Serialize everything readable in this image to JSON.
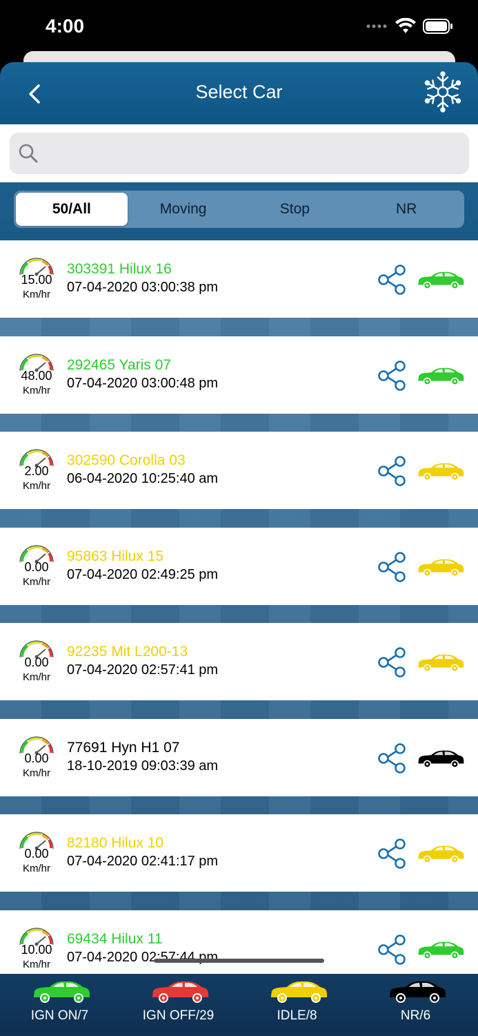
{
  "status_bar": {
    "time": "4:00"
  },
  "header": {
    "title": "Select Car",
    "back_icon": "chevron-left-icon",
    "action_icon": "snowflake-icon"
  },
  "search": {
    "placeholder": "",
    "value": ""
  },
  "filters": {
    "tabs": [
      {
        "label": "50/All",
        "active": true
      },
      {
        "label": "Moving"
      },
      {
        "label": "Stop"
      },
      {
        "label": "NR"
      }
    ]
  },
  "colors": {
    "green": "#2ecc2e",
    "yellow": "#f0d000",
    "red": "#e53935",
    "black": "#000000",
    "header": "#0f5585",
    "share": "#1b6fae"
  },
  "speed_unit": "Km/hr",
  "vehicles": [
    {
      "speed": "15.00",
      "name": "303391 Hilux 16",
      "datetime": "07-04-2020 03:00:38 pm",
      "status": "green"
    },
    {
      "speed": "48.00",
      "name": "292465 Yaris 07",
      "datetime": "07-04-2020 03:00:48 pm",
      "status": "green"
    },
    {
      "speed": "2.00",
      "name": "302590 Corolla 03",
      "datetime": "06-04-2020 10:25:40 am",
      "status": "yellow"
    },
    {
      "speed": "0.00",
      "name": "95863 Hilux 15",
      "datetime": "07-04-2020 02:49:25 pm",
      "status": "yellow"
    },
    {
      "speed": "0.00",
      "name": "92235 Mit L200-13",
      "datetime": "07-04-2020 02:57:41 pm",
      "status": "yellow"
    },
    {
      "speed": "0.00",
      "name": "77691 Hyn H1 07",
      "datetime": "18-10-2019 09:03:39 am",
      "status": "black"
    },
    {
      "speed": "0.00",
      "name": "82180 Hilux 10",
      "datetime": "07-04-2020 02:41:17 pm",
      "status": "yellow"
    },
    {
      "speed": "10.00",
      "name": "69434 Hilux 11",
      "datetime": "07-04-2020 02:57:44 pm",
      "status": "green"
    }
  ],
  "bottom_tabs": [
    {
      "label": "IGN ON/7",
      "status": "green"
    },
    {
      "label": "IGN OFF/29",
      "status": "red"
    },
    {
      "label": "IDLE/8",
      "status": "yellow"
    },
    {
      "label": "NR/6",
      "status": "black"
    }
  ]
}
